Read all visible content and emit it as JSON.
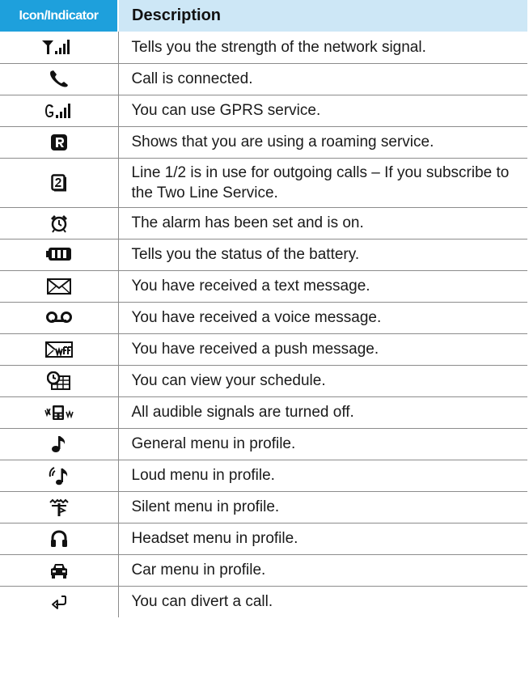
{
  "header": {
    "icon_col": "Icon/Indicator",
    "desc_col": "Description"
  },
  "rows": [
    {
      "icon": "signal-strength-icon",
      "description": "Tells you the strength of the network signal."
    },
    {
      "icon": "phone-handset-icon",
      "description": "Call is connected."
    },
    {
      "icon": "gprs-signal-icon",
      "description": "You can use GPRS service."
    },
    {
      "icon": "roaming-icon",
      "description": "Shows that you are using a roaming service."
    },
    {
      "icon": "line-2-icon",
      "description": "Line 1/2 is in use for outgoing calls – If you subscribe to the Two Line Service."
    },
    {
      "icon": "alarm-clock-icon",
      "description": "The alarm has been set and is on."
    },
    {
      "icon": "battery-icon",
      "description": "Tells you the status of the battery."
    },
    {
      "icon": "envelope-icon",
      "description": "You have received a text message."
    },
    {
      "icon": "voicemail-icon",
      "description": "You have received a voice message."
    },
    {
      "icon": "push-message-icon",
      "description": "You have received a push message."
    },
    {
      "icon": "schedule-icon",
      "description": "You can view your schedule."
    },
    {
      "icon": "vibrate-silent-icon",
      "description": "All audible signals are turned off."
    },
    {
      "icon": "music-note-icon",
      "description": "General menu in profile."
    },
    {
      "icon": "loud-speaker-icon",
      "description": "Loud menu in profile."
    },
    {
      "icon": "silent-profile-icon",
      "description": "Silent menu in profile."
    },
    {
      "icon": "headset-icon",
      "description": "Headset menu in profile."
    },
    {
      "icon": "car-icon",
      "description": "Car menu in profile."
    },
    {
      "icon": "call-divert-icon",
      "description": "You can divert a call."
    }
  ]
}
